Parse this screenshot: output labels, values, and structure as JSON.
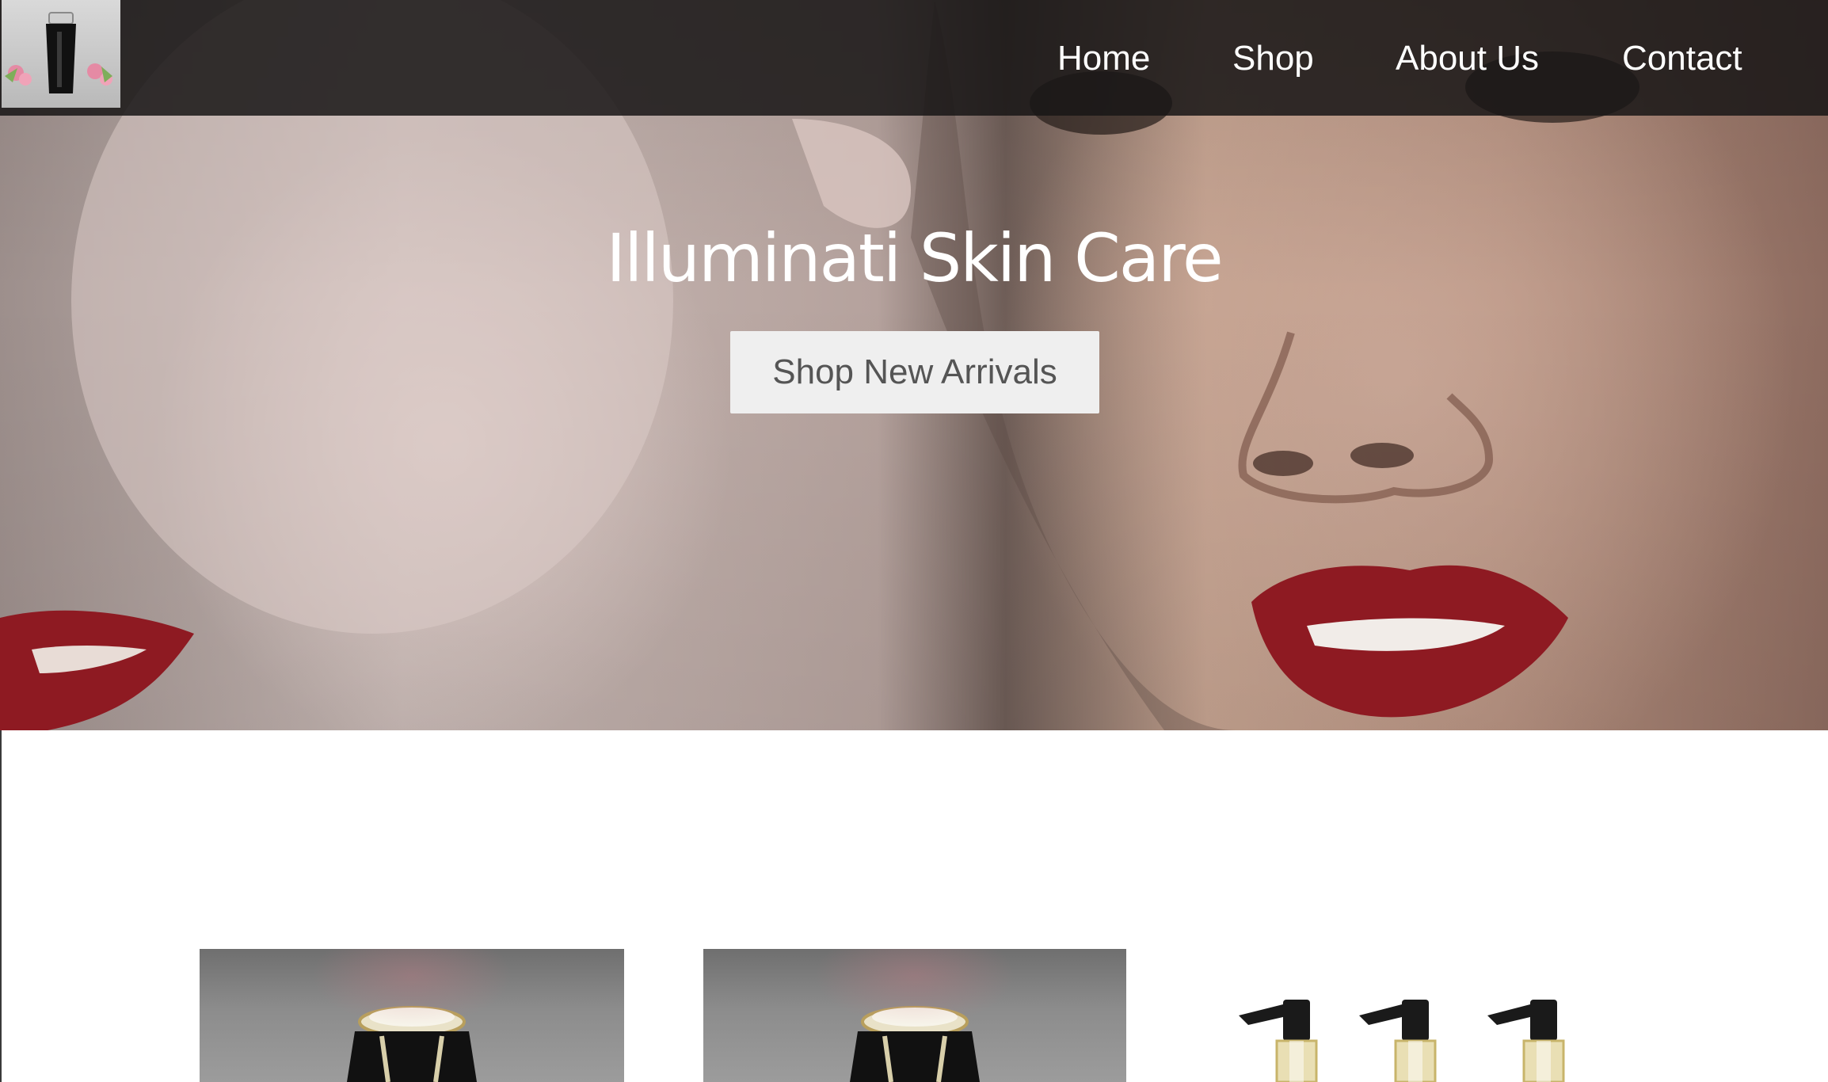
{
  "brand": {
    "logo_icon": "serum-bottle-logo"
  },
  "nav": {
    "items": [
      {
        "label": "Home"
      },
      {
        "label": "Shop"
      },
      {
        "label": "About Us"
      },
      {
        "label": "Contact"
      }
    ]
  },
  "hero": {
    "title": "Illuminati Skin Care",
    "cta_label": "Shop New Arrivals"
  },
  "products": [
    {
      "image_icon": "cream-jar-image"
    },
    {
      "image_icon": "cream-jar-image"
    },
    {
      "image_icon": "pump-bottles-image"
    }
  ],
  "colors": {
    "nav_background": "#181616",
    "nav_text": "#ffffff",
    "cta_background": "#efefef",
    "cta_text": "#555555",
    "lip_red": "#8e1a22"
  }
}
